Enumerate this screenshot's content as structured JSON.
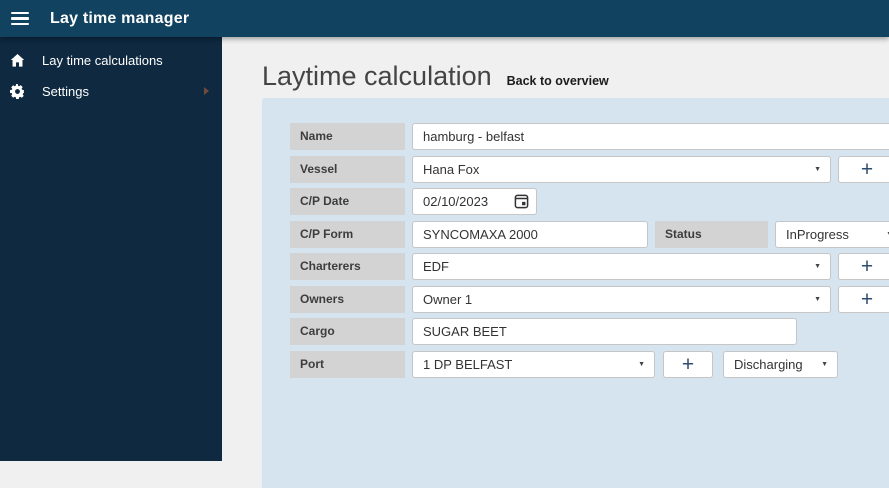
{
  "topbar": {
    "title": "Lay time manager"
  },
  "sidebar": {
    "items": [
      {
        "icon": "home-icon",
        "label": "Lay time calculations"
      },
      {
        "icon": "gear-icon",
        "label": "Settings"
      }
    ]
  },
  "page": {
    "title": "Laytime calculation",
    "back_link": "Back to overview"
  },
  "form": {
    "add_label": "+",
    "fields": {
      "name": {
        "label": "Name",
        "value": "hamburg - belfast"
      },
      "vessel": {
        "label": "Vessel",
        "value": "Hana Fox"
      },
      "cp_date": {
        "label": "C/P Date",
        "value": "02/10/2023"
      },
      "cp_form": {
        "label": "C/P Form",
        "value": "SYNCOMAXA 2000"
      },
      "status": {
        "label": "Status",
        "value": "InProgress"
      },
      "charterers": {
        "label": "Charterers",
        "value": "EDF"
      },
      "owners": {
        "label": "Owners",
        "value": "Owner 1"
      },
      "cargo": {
        "label": "Cargo",
        "value": "SUGAR BEET"
      },
      "port": {
        "label": "Port",
        "value": "1 DP BELFAST",
        "operation": "Discharging"
      }
    }
  },
  "colors": {
    "topbar": "#11425f",
    "sidebar": "#0e2940",
    "content_bg": "#f0f0f0",
    "panel": "#d6e4f0",
    "label_bg": "#d3d3d3",
    "plus_accent": "#2f4d6e"
  }
}
